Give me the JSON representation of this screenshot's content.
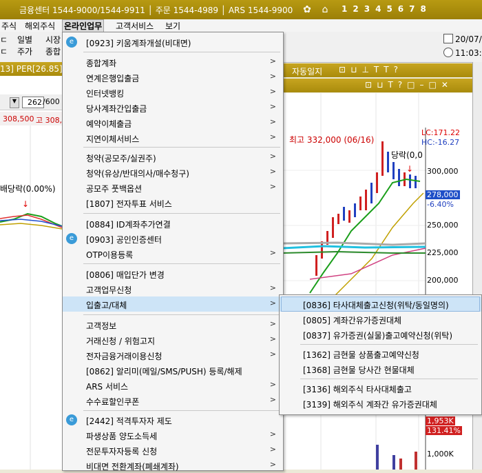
{
  "topbar": {
    "info": "금융센터 1544-9000/1544-9911 │ 주문 1544-4989 │ ARS 1544-9900",
    "page_numbers": [
      "1",
      "2",
      "3",
      "4",
      "5",
      "6",
      "7",
      "8"
    ]
  },
  "menubar": {
    "items": [
      "주식",
      "해외주식",
      "온라인업무",
      "고객서비스",
      "보기"
    ]
  },
  "toolbar": {
    "items": [
      {
        "line1": "일별",
        "line2": "주가"
      },
      {
        "line1": "시장",
        "line2": "종합"
      }
    ],
    "date": "20/07/",
    "time": "11:03:"
  },
  "window_title_left": {
    "text": "13] PER[26.85]"
  },
  "window_title_right_top": {
    "text": "자동일지"
  },
  "stock_input": {
    "value": "262",
    "suffix": "/600"
  },
  "price_row": {
    "p1": "308,500",
    "p2": "고 308,"
  },
  "chart": {
    "left_annotation": "배당락(0.00%)",
    "right_annotation_high": "최고 332,000 (06/16)",
    "right_annotation_div": "당락(0,0",
    "lc": "LC:171.22",
    "hc": "HC:-16.27",
    "y_ticks": [
      "300,000",
      "278,000",
      "-6.40%",
      "250,000",
      "225,000",
      "200,000"
    ],
    "vol_label1": "1,953K",
    "vol_label2": "131.41%",
    "vol_tick": "1,000K",
    "vol_partial": "1,953K"
  },
  "dropdown": {
    "items": [
      {
        "label": "[0923] 키움계좌개설(비대면)",
        "icon": true,
        "arrow": false
      },
      {
        "label": "종합계좌",
        "arrow": true
      },
      {
        "label": "연계은행입출금",
        "arrow": true
      },
      {
        "label": "인터넷뱅킹",
        "arrow": true
      },
      {
        "label": "당사계좌간입출금",
        "arrow": true
      },
      {
        "label": "예약이체출금",
        "arrow": true
      },
      {
        "label": "지연이체서비스",
        "arrow": true
      },
      {
        "label": "청약(공모주/실권주)",
        "arrow": true
      },
      {
        "label": "청약(유상/반대의사/매수청구)",
        "arrow": true
      },
      {
        "label": "공모주 풋백옵션",
        "arrow": true
      },
      {
        "label": "[1807] 전자투표 서비스",
        "arrow": false
      },
      {
        "label": "[0884] ID계좌추가연결",
        "arrow": false
      },
      {
        "label": "[0903] 공인인증센터",
        "icon": true,
        "arrow": false
      },
      {
        "label": "OTP이용등록",
        "arrow": true
      },
      {
        "label": "[0806] 매입단가 변경",
        "arrow": false
      },
      {
        "label": "고객업무신청",
        "arrow": true
      },
      {
        "label": "입출고/대체",
        "arrow": true
      },
      {
        "label": "고객정보",
        "arrow": true
      },
      {
        "label": "거래신청 / 위험고지",
        "arrow": true
      },
      {
        "label": "전자금융거래이용신청",
        "arrow": true
      },
      {
        "label": "[0862] 알리미(메일/SMS/PUSH) 등록/해제",
        "arrow": false
      },
      {
        "label": "ARS 서비스",
        "arrow": true
      },
      {
        "label": "수수료할인쿠폰",
        "arrow": true
      },
      {
        "label": "[2442] 적격투자자 제도",
        "icon": true,
        "arrow": false
      },
      {
        "label": "파생상품 양도소득세",
        "arrow": true
      },
      {
        "label": "전문투자자등록 신청",
        "arrow": true
      },
      {
        "label": "비대면 전환계좌(폐쇄계좌)",
        "arrow": true
      }
    ]
  },
  "submenu": {
    "items": [
      "[0836] 타사대체출고신청(위탁/동일명의)",
      "[0805] 계좌간유가증권대체",
      "[0837] 유가증권(실물)출고예약신청(위탁)",
      "[1362] 금현물 상품출고예약신청",
      "[1368] 금현물 당사간 현물대체",
      "[3136] 해외주식 타사대체출고",
      "[3139] 해외주식 계좌간 유가증권대체"
    ]
  }
}
